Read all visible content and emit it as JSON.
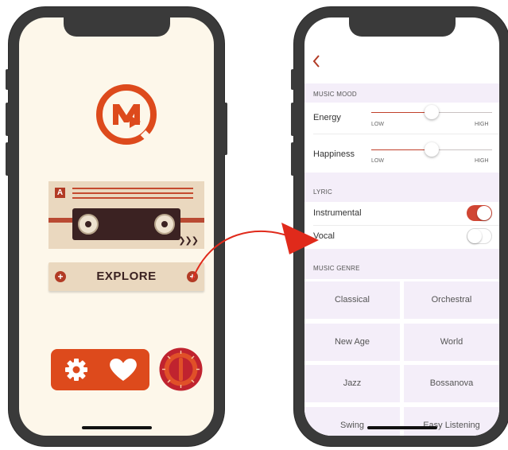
{
  "left_screen": {
    "cassette": {
      "side_letter": "A",
      "arrows": "❯❯❯"
    },
    "explore_label": "EXPLORE",
    "colors": {
      "accent": "#dd4a1c",
      "dark": "#3b2222",
      "paper": "#fdf7ea",
      "tape": "#ead8bf"
    }
  },
  "right_screen": {
    "music_mood": {
      "header": "MUSIC MOOD",
      "sliders": [
        {
          "label": "Energy",
          "low": "LOW",
          "high": "HIGH",
          "value": 0.5
        },
        {
          "label": "Happiness",
          "low": "LOW",
          "high": "HIGH",
          "value": 0.5
        }
      ]
    },
    "lyric": {
      "header": "LYRIC",
      "options": [
        {
          "label": "Instrumental",
          "on": true
        },
        {
          "label": "Vocal",
          "on": false
        }
      ]
    },
    "music_genre": {
      "header": "MUSIC GENRE",
      "genres": [
        "Classical",
        "Orchestral",
        "New Age",
        "World",
        "Jazz",
        "Bossanova",
        "Swing",
        "Easy Listening"
      ]
    },
    "colors": {
      "accent": "#c1402b",
      "section_bg": "#f4eef9"
    }
  }
}
